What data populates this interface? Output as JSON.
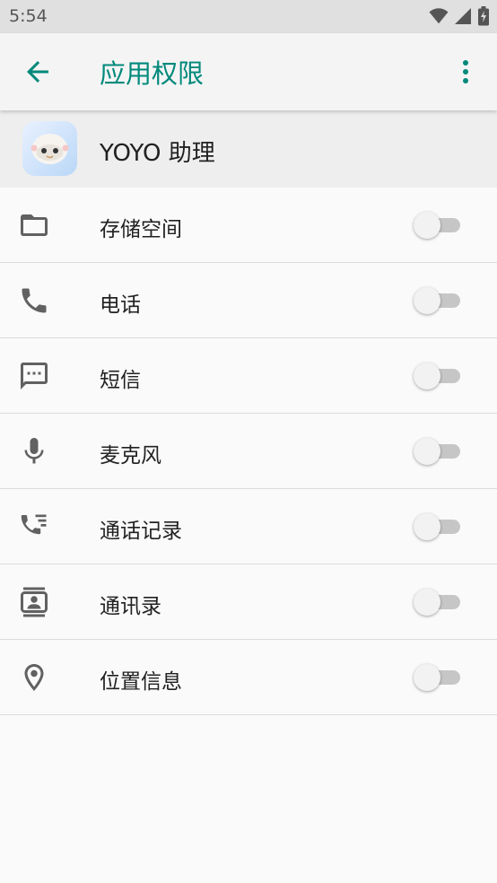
{
  "status_bar": {
    "time": "5:54"
  },
  "app_bar": {
    "title": "应用权限",
    "back_icon": "arrow-back-icon",
    "menu_icon": "more-vert-icon"
  },
  "app": {
    "name": "YOYO 助理"
  },
  "colors": {
    "accent": "#00897b",
    "icon_gray": "#616161",
    "switch_track_off": "#c6c6c6",
    "switch_thumb_off": "#f2f2f2"
  },
  "permissions": [
    {
      "label": "存储空间",
      "icon": "folder-icon",
      "enabled": false
    },
    {
      "label": "电话",
      "icon": "phone-icon",
      "enabled": false
    },
    {
      "label": "短信",
      "icon": "sms-icon",
      "enabled": false
    },
    {
      "label": "麦克风",
      "icon": "microphone-icon",
      "enabled": false
    },
    {
      "label": "通话记录",
      "icon": "call-log-icon",
      "enabled": false
    },
    {
      "label": "通讯录",
      "icon": "contacts-icon",
      "enabled": false
    },
    {
      "label": "位置信息",
      "icon": "location-icon",
      "enabled": false
    }
  ]
}
